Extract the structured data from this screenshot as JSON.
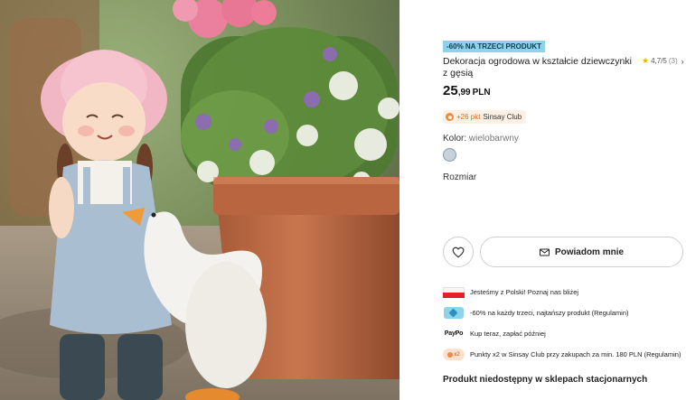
{
  "product": {
    "promo_badge": "-60% NA TRZECI PRODUKT",
    "title": "Dekoracja ogrodowa w kształcie dziewczynki z gęsią",
    "price_whole": "25",
    "price_decimal": ",99",
    "currency": "PLN",
    "rating": {
      "star_icon": "star-icon",
      "score": "4,7/5",
      "count": "(3)",
      "chevron": "›"
    },
    "club_points": {
      "points": "+26 pkt",
      "club_name": "Sinsay Club"
    },
    "color": {
      "label": "Kolor:",
      "value": "wielobarwny",
      "swatch_color": "#c8d2dc"
    },
    "size_label": "Rozmiar"
  },
  "actions": {
    "favorite_icon": "heart-icon",
    "notify_icon": "envelope-icon",
    "notify_label": "Powiadom mnie"
  },
  "perks": [
    {
      "icon": "polish-flag-icon",
      "text": "Jesteśmy z Polski! Poznaj nas bliżej"
    },
    {
      "icon": "discount-tag-icon",
      "text": "-60% na każdy trzeci, najtańszy produkt (Regulamin)"
    },
    {
      "icon": "paypo-logo",
      "logo_text": "PayPo",
      "text": "Kup teraz, zapłać później"
    },
    {
      "icon": "club-points-icon",
      "badge_text": "x2",
      "text": "Punkty x2 w Sinsay Club przy zakupach za min. 180 PLN (Regulamin)"
    }
  ],
  "store_availability": "Produkt niedostępny w sklepach stacjonarnych",
  "colors": {
    "promo_bg": "#8fd3ea",
    "club_accent": "#f08a3c",
    "star": "#f0b400",
    "flag_red": "#e2202c"
  }
}
